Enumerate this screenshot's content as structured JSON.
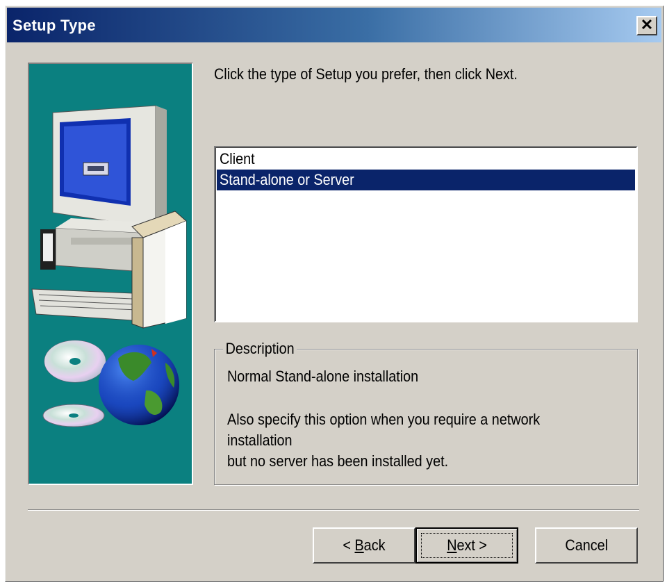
{
  "window": {
    "title": "Setup Type",
    "close_glyph": "✕"
  },
  "instruction": "Click the type of Setup you prefer, then click Next.",
  "setup_types": {
    "items": [
      {
        "label": "Client",
        "selected": false
      },
      {
        "label": "Stand-alone or Server",
        "selected": true
      }
    ]
  },
  "description": {
    "legend": "Description",
    "lines": [
      "Normal Stand-alone installation",
      "",
      "Also specify this option when you require a network",
      "installation",
      "but no server has been installed yet."
    ]
  },
  "buttons": {
    "back": {
      "prefix": "< ",
      "mnemonic": "B",
      "rest": "ack"
    },
    "next": {
      "prefix": "",
      "mnemonic": "N",
      "rest": "ext >"
    },
    "cancel": "Cancel"
  },
  "colors": {
    "dialog_bg": "#d4d0c8",
    "title_start": "#0a246a",
    "title_end": "#a6caf0",
    "selection": "#0a246a",
    "art_bg": "#0b8080"
  },
  "icons": {
    "art": "computer-with-box-cd-globe-illustration",
    "close": "close-icon"
  }
}
